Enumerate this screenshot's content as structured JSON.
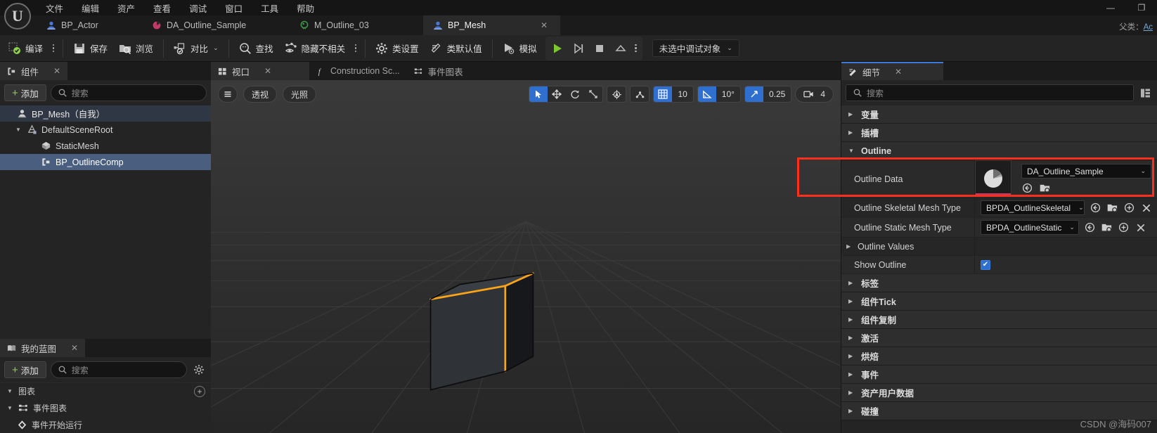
{
  "window": {
    "minimize_label": "—",
    "restore_label": "❐",
    "parent_class_label": "父类：",
    "parent_class_value": "Ac"
  },
  "menubar": {
    "items": [
      {
        "label": "文件"
      },
      {
        "label": "编辑"
      },
      {
        "label": "资产"
      },
      {
        "label": "查看"
      },
      {
        "label": "调试"
      },
      {
        "label": "窗口"
      },
      {
        "label": "工具"
      },
      {
        "label": "帮助"
      }
    ]
  },
  "asset_tabs": [
    {
      "label": "BP_Actor",
      "icon": "blueprint-actor-icon",
      "active": false,
      "closable": false
    },
    {
      "label": "DA_Outline_Sample",
      "icon": "data-asset-icon",
      "active": false,
      "closable": false
    },
    {
      "label": "M_Outline_03",
      "icon": "material-icon",
      "active": false,
      "closable": false
    },
    {
      "label": "BP_Mesh",
      "icon": "blueprint-actor-icon",
      "active": true,
      "closable": true,
      "close_label": "✕"
    }
  ],
  "toolbar": {
    "compile_label": "编译",
    "save_label": "保存",
    "browse_label": "浏览",
    "diff_label": "对比",
    "find_label": "查找",
    "hide_unrelated_label": "隐藏不相关",
    "class_settings_label": "类设置",
    "class_defaults_label": "类默认值",
    "simulate_label": "模拟",
    "play_label": "▶",
    "step_label": "▷|",
    "stop_label": "■",
    "eject_label": "▲",
    "debug_object_label": "未选中调试对象",
    "debug_object_caret": "⌄"
  },
  "components_panel": {
    "tab_label": "组件",
    "tab_close": "✕",
    "add_label": "添加",
    "add_plus": "+",
    "search_placeholder": "搜索",
    "tree": [
      {
        "label": "BP_Mesh（自我）",
        "indent": 0,
        "arrow": "",
        "icon": "actor-icon",
        "state": "hdr"
      },
      {
        "label": "DefaultSceneRoot",
        "indent": 1,
        "arrow": "▼",
        "icon": "scene-root-icon",
        "state": ""
      },
      {
        "label": "StaticMesh",
        "indent": 2,
        "arrow": "",
        "icon": "static-mesh-icon",
        "state": ""
      },
      {
        "label": "BP_OutlineComp",
        "indent": 2,
        "arrow": "",
        "icon": "blueprint-comp-icon",
        "state": "sel"
      }
    ]
  },
  "myblueprint_panel": {
    "tab_label": "我的蓝图",
    "tab_close": "✕",
    "add_label": "添加",
    "add_plus": "+",
    "search_placeholder": "搜索",
    "settings_icon": "gear-icon",
    "sections": [
      {
        "label": "图表",
        "arrow": "▼",
        "has_plus": true,
        "plus_label": "+",
        "icon": ""
      },
      {
        "label": "事件图表",
        "arrow": "▼",
        "has_plus": false,
        "icon": "event-graph-icon"
      },
      {
        "label": "事件开始运行",
        "arrow": "",
        "has_plus": false,
        "icon": "event-node-icon"
      }
    ]
  },
  "viewport_panel": {
    "tabs": [
      {
        "label": "视口",
        "icon": "viewport-icon",
        "active": true,
        "close_label": "✕"
      },
      {
        "label": "Construction Sc...",
        "icon": "function-icon",
        "active": false
      },
      {
        "label": "事件图表",
        "icon": "event-graph-icon",
        "active": false
      }
    ],
    "menu_icon": "hamburger-icon",
    "perspective_label": "透视",
    "lighting_label": "光照",
    "tools": [
      {
        "name": "select-tool",
        "on": true
      },
      {
        "name": "move-tool",
        "on": false
      },
      {
        "name": "rotate-tool",
        "on": false
      },
      {
        "name": "scale-tool",
        "on": false
      }
    ],
    "coord_space_icon": "world-coords-icon",
    "surface_snap_icon": "surface-snap-icon",
    "grid_snap_value": "10",
    "angle_snap_value": "10°",
    "scale_snap_value": "0.25",
    "camera_speed_value": "4"
  },
  "details_panel": {
    "tab_label": "细节",
    "tab_close": "✕",
    "search_placeholder": "搜索",
    "columns_icon": "columns-icon",
    "categories": [
      {
        "label": "变量",
        "arrow": "▶",
        "expanded": false
      },
      {
        "label": "插槽",
        "arrow": "▶",
        "expanded": false
      },
      {
        "label": "Outline",
        "arrow": "▼",
        "expanded": true
      }
    ],
    "outline_rows": [
      {
        "label": "Outline Data",
        "type": "asset",
        "value": "DA_Outline_Sample",
        "caret": "⌄",
        "thumbnail": "data-asset-pie-icon",
        "buttons": [
          "browse-to-asset-icon",
          "use-selected-asset-icon"
        ],
        "highlighted": true
      },
      {
        "label": "Outline Skeletal Mesh Type",
        "type": "class",
        "value": "BPDA_OutlineSkeletal",
        "caret": "⌄",
        "buttons": [
          "browse-to-asset-icon",
          "use-selected-asset-icon",
          "insert-icon",
          "clear-icon"
        ],
        "highlighted": false
      },
      {
        "label": "Outline Static Mesh Type",
        "type": "class",
        "value": "BPDA_OutlineStatic",
        "caret": "⌄",
        "buttons": [
          "browse-to-asset-icon",
          "use-selected-asset-icon",
          "insert-icon",
          "clear-icon"
        ],
        "highlighted": false
      },
      {
        "label": "Outline Values",
        "type": "expander",
        "arrow": "▶",
        "value": "",
        "highlighted": false
      },
      {
        "label": "Show Outline",
        "type": "checkbox",
        "checked": true,
        "check_glyph": "✔",
        "highlighted": false
      }
    ],
    "other_categories": [
      {
        "label": "标签",
        "arrow": "▶"
      },
      {
        "label": "组件Tick",
        "arrow": "▶"
      },
      {
        "label": "组件复制",
        "arrow": "▶"
      },
      {
        "label": "激活",
        "arrow": "▶"
      },
      {
        "label": "烘焙",
        "arrow": "▶"
      },
      {
        "label": "事件",
        "arrow": "▶"
      },
      {
        "label": "资产用户数据",
        "arrow": "▶"
      },
      {
        "label": "碰撞",
        "arrow": "▶"
      }
    ]
  },
  "watermark": {
    "text": "CSDN @海码007"
  },
  "colors": {
    "accent_blue": "#2f6fd0",
    "selection_blue": "#4a5f80",
    "highlight_red": "#ff2f1e",
    "compile_green": "#8fd14f",
    "data_asset_pink": "#c23a6a",
    "material_green": "#3f9a4a",
    "outline_orange": "#ffa317"
  }
}
